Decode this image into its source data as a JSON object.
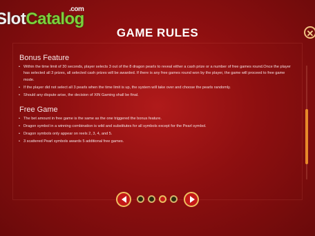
{
  "watermark": {
    "part1": "Slot",
    "part2": "Catalog",
    "suffix": ".com"
  },
  "title": "GAME RULES",
  "close_glyph": "✕",
  "sections": [
    {
      "heading": "Bonus Feature",
      "items": [
        "Within the time limit of 30 seconds, player selects 3 out of the 8 dragon pearls to reveal either a cash prize or a number of free games round.Once the player has selected all 3 prizes, all selected cash prizes will be awarded. If there is any free games round won by the player, the game will proceed to free game mode.",
        "If the player did not select all 3 pearls when the time limit is up, the system will take over and choose the pearls randomly.",
        "Should any dispute arise, the decision of XIN Gaming shall be final."
      ]
    },
    {
      "heading": "Free Game",
      "items": [
        "The bet amount in free game is the same as the one triggered the bonus feature.",
        "Dragon symbol in a winning combination is wild and substitutes for all symbols except for the Pearl symbol.",
        "Dragon symbols only appear on reels 2, 3, 4, and 5.",
        "3 scattered Pearl symbols awards 5 additional free games."
      ]
    }
  ],
  "pagination": {
    "pages": 4,
    "current": 3
  },
  "icons": {
    "prev": "chevron-left-icon",
    "next": "chevron-right-icon",
    "close": "close-icon"
  },
  "colors": {
    "background": "#8e0f10",
    "accent": "#f0c060",
    "scrollbar": "#e8892a"
  }
}
